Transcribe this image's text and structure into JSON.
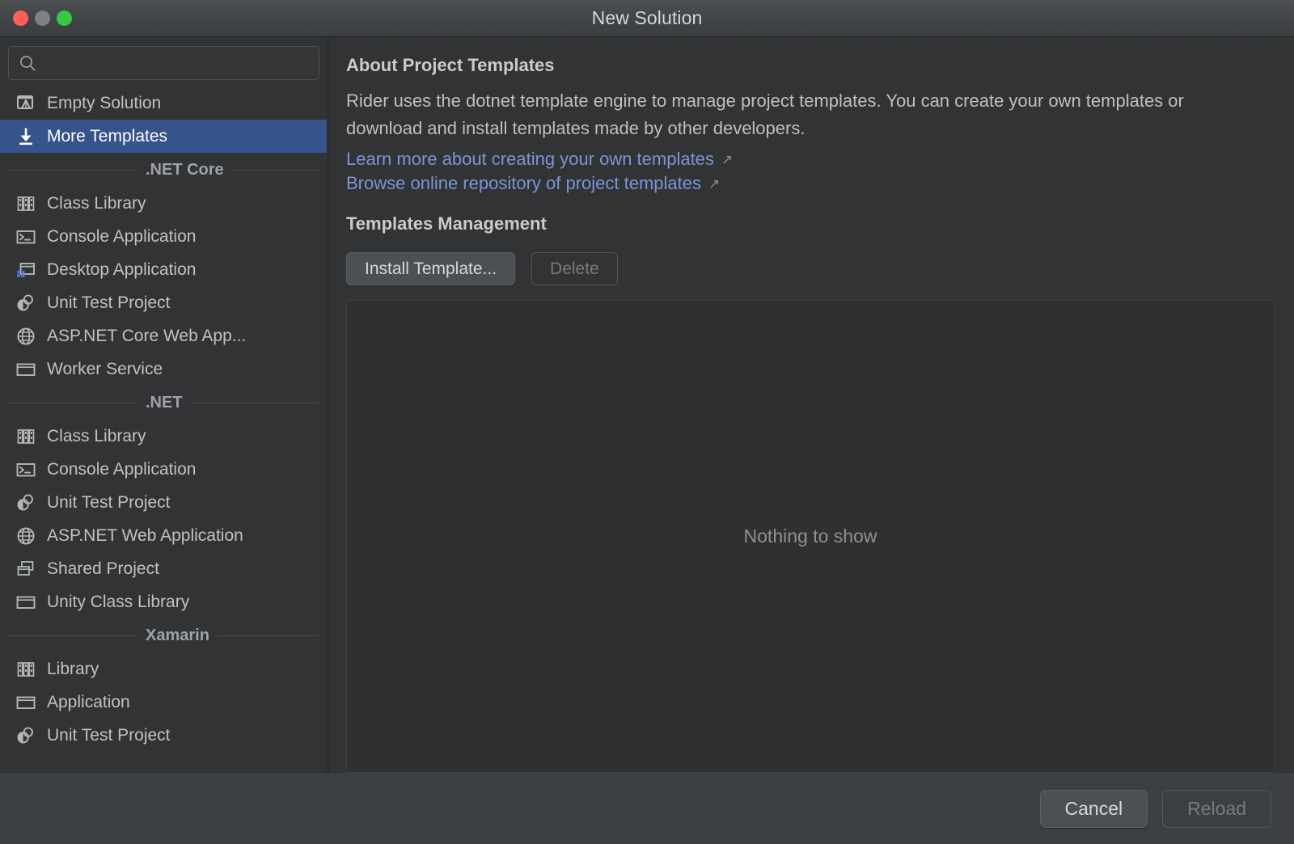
{
  "window": {
    "title": "New Solution",
    "traffic_lights": [
      "close-button",
      "minimize-button",
      "zoom-button"
    ],
    "colors": {
      "close": "#ff5f57",
      "minimize": "#7d8084",
      "zoom": "#35c941",
      "selection": "#36538c",
      "link": "#7a94d6",
      "background": "#313335",
      "titlebar": "#424547"
    }
  },
  "search": {
    "value": "",
    "placeholder": "",
    "icon": "search-icon"
  },
  "sidebar": {
    "top_items": [
      {
        "label": "Empty Solution",
        "icon": "empty-solution-icon",
        "selected": false
      },
      {
        "label": "More Templates",
        "icon": "download-icon",
        "selected": true
      }
    ],
    "groups": [
      {
        "title": ".NET Core",
        "items": [
          {
            "label": "Class Library",
            "icon": "class-library-icon"
          },
          {
            "label": "Console Application",
            "icon": "console-icon"
          },
          {
            "label": "Desktop Application",
            "icon": "desktop-window-icon"
          },
          {
            "label": "Unit Test Project",
            "icon": "unit-test-icon"
          },
          {
            "label": "ASP.NET Core Web App...",
            "icon": "globe-icon"
          },
          {
            "label": "Worker Service",
            "icon": "window-icon"
          }
        ]
      },
      {
        "title": ".NET",
        "items": [
          {
            "label": "Class Library",
            "icon": "class-library-icon"
          },
          {
            "label": "Console Application",
            "icon": "console-icon"
          },
          {
            "label": "Unit Test Project",
            "icon": "unit-test-icon"
          },
          {
            "label": "ASP.NET Web Application",
            "icon": "globe-icon"
          },
          {
            "label": "Shared Project",
            "icon": "shared-project-icon"
          },
          {
            "label": "Unity Class Library",
            "icon": "window-icon"
          }
        ]
      },
      {
        "title": "Xamarin",
        "items": [
          {
            "label": "Library",
            "icon": "class-library-icon"
          },
          {
            "label": "Application",
            "icon": "window-icon"
          },
          {
            "label": "Unit Test Project",
            "icon": "unit-test-icon"
          }
        ]
      }
    ]
  },
  "detail": {
    "about_heading": "About Project Templates",
    "about_body": "Rider uses the dotnet template engine to manage project templates. You can create your own templates or download and install templates made by other developers.",
    "links": [
      {
        "text": "Learn more about creating your own templates",
        "icon": "external-link-icon"
      },
      {
        "text": "Browse online repository of project templates",
        "icon": "external-link-icon"
      }
    ],
    "management_heading": "Templates Management",
    "install_button": "Install Template...",
    "delete_button": "Delete",
    "empty_message": "Nothing to show"
  },
  "footer": {
    "cancel_button": "Cancel",
    "reload_button": "Reload"
  }
}
